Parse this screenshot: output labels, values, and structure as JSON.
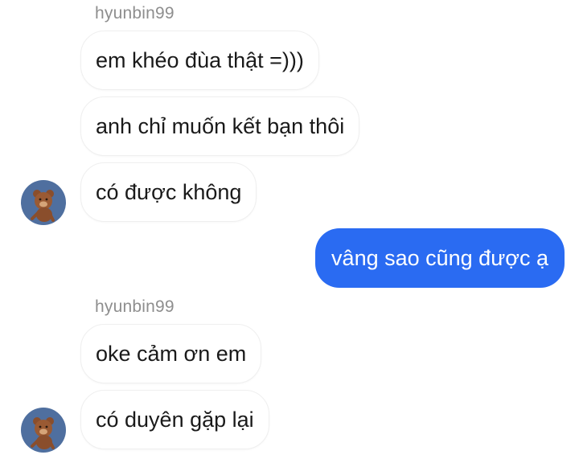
{
  "theme": {
    "outgoing_bubble_color": "#2a6bf2",
    "avatar_bg_color": "#4f6f9f"
  },
  "conversation": {
    "groups": [
      {
        "sender": "hyunbin99",
        "messages": [
          "em khéo đùa thật =)))",
          "anh chỉ muốn kết bạn thôi",
          "có được không"
        ]
      },
      {
        "outgoing": [
          "vâng sao cũng được ạ"
        ]
      },
      {
        "sender": "hyunbin99",
        "messages": [
          "oke cảm ơn em",
          "có duyên gặp lại"
        ]
      }
    ]
  },
  "avatar_icon": "teddy-bear-icon"
}
